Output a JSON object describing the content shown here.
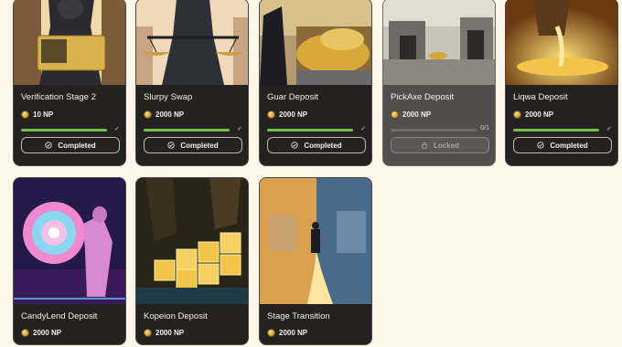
{
  "cards": [
    {
      "title": "Verification Stage 2",
      "reward": "10 NP",
      "progress": 1.0,
      "progress_text": "✓",
      "status": "Completed",
      "status_icon": "check-circle-icon",
      "art": "warrior-card",
      "art_text": "NOMIZEN ID"
    },
    {
      "title": "Slurpy Swap",
      "reward": "2000 NP",
      "progress": 1.0,
      "progress_text": "✓",
      "status": "Completed",
      "status_icon": "check-circle-icon",
      "art": "scales"
    },
    {
      "title": "Guar Deposit",
      "reward": "2000 NP",
      "progress": 1.0,
      "progress_text": "✓",
      "status": "Completed",
      "status_icon": "check-circle-icon",
      "art": "treasure-knight"
    },
    {
      "title": "PickAxe Deposit",
      "reward": "2000 NP",
      "progress": 0.0,
      "progress_text": "0/1",
      "status": "Locked",
      "status_icon": "lock-icon",
      "art": "mine"
    },
    {
      "title": "Liqwa Deposit",
      "reward": "2000 NP",
      "progress": 1.0,
      "progress_text": "✓",
      "status": "Completed",
      "status_icon": "check-circle-icon",
      "art": "gold-pour"
    },
    {
      "title": "CandyLend Deposit",
      "reward": "2000 NP",
      "art": "candy"
    },
    {
      "title": "Kopeion Deposit",
      "reward": "2000 NP",
      "art": "gold-cubes"
    },
    {
      "title": "Stage Transition",
      "reward": "2000 NP",
      "art": "temple-path"
    }
  ]
}
